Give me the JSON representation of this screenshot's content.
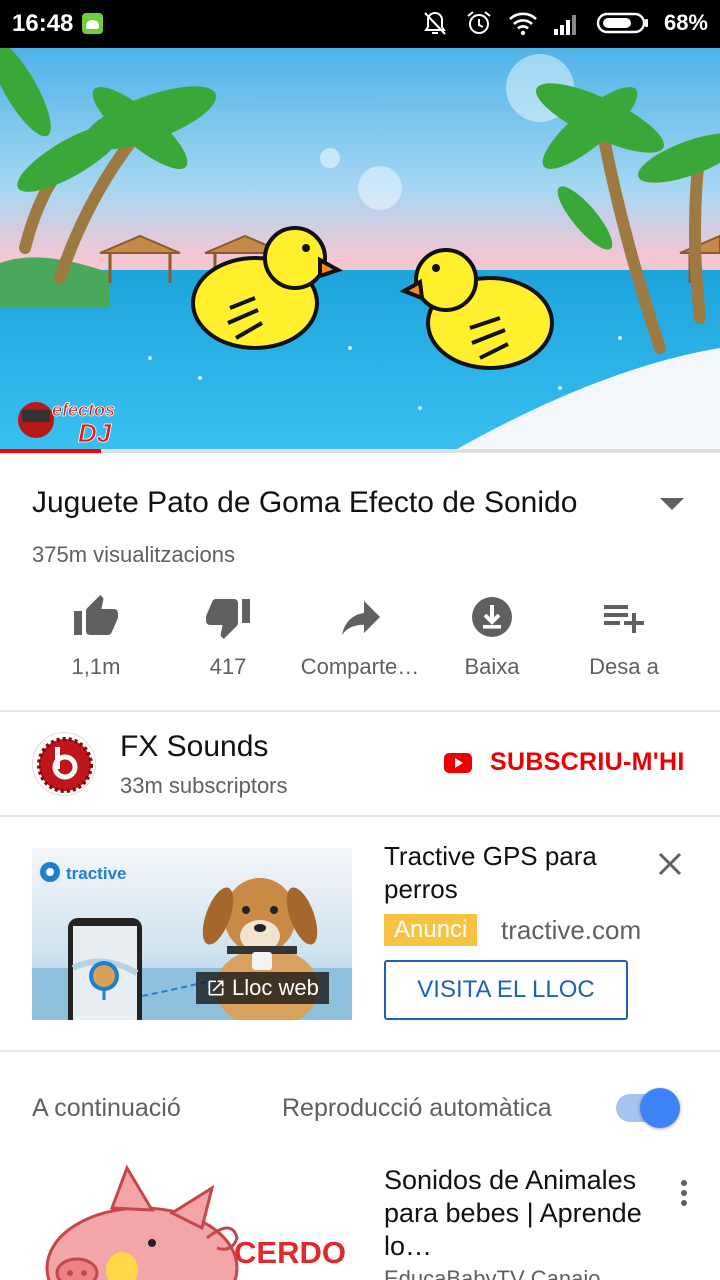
{
  "status_bar": {
    "time": "16:48",
    "battery": "68%",
    "icons": [
      "android-icon",
      "bell-off-icon",
      "alarm-icon",
      "wifi-icon",
      "signal-icon",
      "battery-icon"
    ]
  },
  "player": {
    "watermark": "efectos DJ",
    "progress": 0.14,
    "accent_color": "#ff0000"
  },
  "video": {
    "title": "Juguete Pato de Goma Efecto de Sonido",
    "views": "375m visualitzacions"
  },
  "actions": [
    {
      "name": "like",
      "icon": "thumbs-up-icon",
      "label": "1,1m"
    },
    {
      "name": "dislike",
      "icon": "thumbs-down-icon",
      "label": "417"
    },
    {
      "name": "share",
      "icon": "share-icon",
      "label": "Comparte…"
    },
    {
      "name": "download",
      "icon": "download-icon",
      "label": "Baixa"
    },
    {
      "name": "save",
      "icon": "playlist-add-icon",
      "label": "Desa a"
    }
  ],
  "channel": {
    "name": "FX Sounds",
    "subscribers": "33m subscriptors",
    "subscribe_label": "SUBSCRIU-M'HI"
  },
  "ad": {
    "brand": "tractive",
    "title": "Tractive GPS para perros",
    "badge": "Anunci",
    "domain": "tractive.com",
    "cta": "VISITA EL LLOC",
    "site_label": "Lloc web",
    "badge_color": "#f6c342",
    "cta_color": "#1c62b9"
  },
  "up_next": {
    "label": "A continuació",
    "autoplay_label": "Reproducció automàtica",
    "autoplay_on": true,
    "item": {
      "thumb_text": "CERDO",
      "title": "Sonidos de Animales para bebes | Aprende lo…",
      "channel": "EducaBabyTV Canaio"
    }
  }
}
